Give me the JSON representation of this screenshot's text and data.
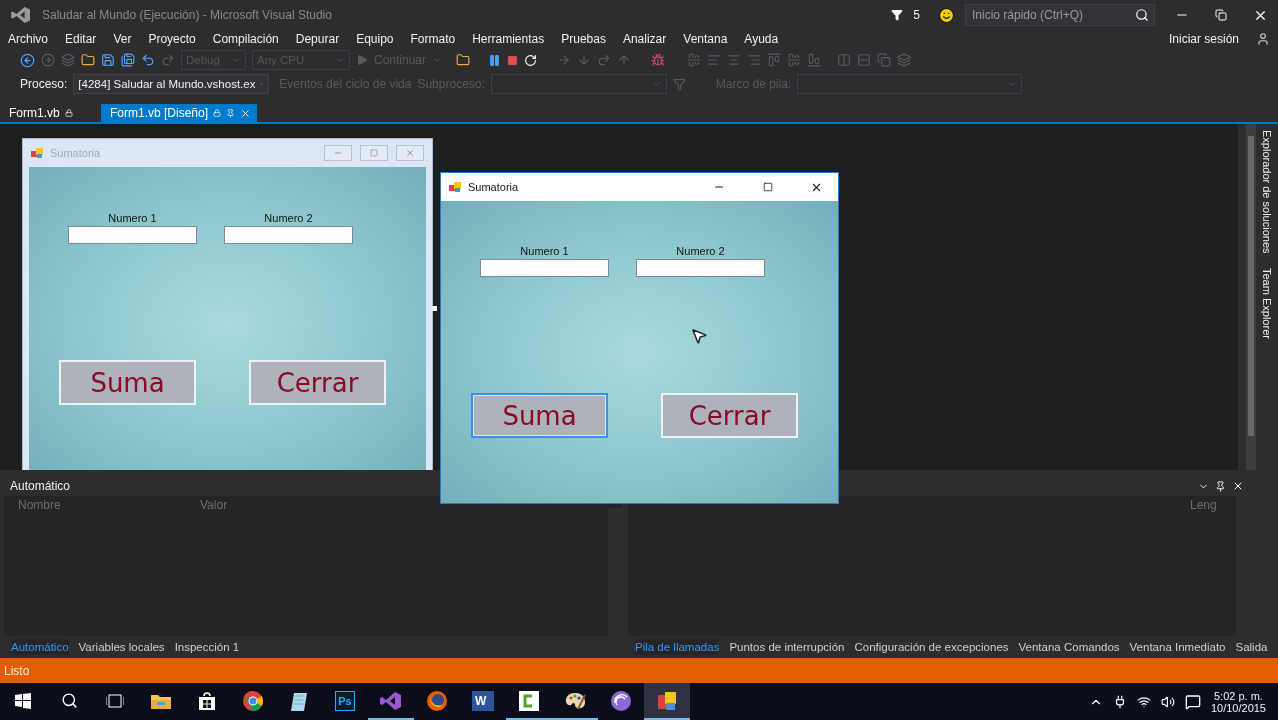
{
  "window": {
    "title": "Saludar al Mundo (Ejecución) - Microsoft Visual Studio"
  },
  "title_bar": {
    "notifications": "5",
    "quick_launch": {
      "placeholder": "Inicio rápido (Ctrl+Q)"
    }
  },
  "menu": [
    "Archivo",
    "Editar",
    "Ver",
    "Proyecto",
    "Compilación",
    "Depurar",
    "Equipo",
    "Formato",
    "Herramientas",
    "Pruebas",
    "Analizar",
    "Ventana",
    "Ayuda"
  ],
  "sign_in": "Iniciar sesión",
  "toolbar": {
    "configuration": "Debug",
    "platform": "Any CPU",
    "continue": "Continuar"
  },
  "debug_location": {
    "process_label": "Proceso:",
    "process": "[4284] Saludar al Mundo.vshost.ex",
    "lifecycle": "Eventos del ciclo de vida",
    "thread_label": "Subproceso:",
    "frame_label": "Marco de pila:"
  },
  "doc_tabs": [
    {
      "label": "Form1.vb",
      "selected": false
    },
    {
      "label": "Form1.vb [Diseño]",
      "selected": true
    }
  ],
  "side_tabs": [
    "Explorador de soluciones",
    "Team Explorer"
  ],
  "designer_form": {
    "title": "Sumatoria",
    "fields": [
      {
        "label": "Numero 1"
      },
      {
        "label": "Numero 2"
      }
    ],
    "buttons": [
      {
        "label": "Suma",
        "focused": false
      },
      {
        "label": "Cerrar",
        "focused": false
      }
    ]
  },
  "running_form": {
    "title": "Sumatoria",
    "fields": [
      {
        "label": "Numero 1"
      },
      {
        "label": "Numero 2"
      }
    ],
    "buttons": [
      {
        "label": "Suma",
        "focused": true
      },
      {
        "label": "Cerrar",
        "focused": false
      }
    ]
  },
  "autos_panel": {
    "title": "Automático",
    "columns": [
      "Nombre",
      "Valor"
    ],
    "tabs": [
      {
        "label": "Automático",
        "selected": true
      },
      {
        "label": "Variables locales",
        "selected": false
      },
      {
        "label": "Inspección 1",
        "selected": false
      }
    ]
  },
  "call_stack_panel": {
    "columns": [
      "Leng"
    ],
    "tabs": [
      {
        "label": "Pila de llamadas",
        "selected": true
      },
      {
        "label": "Puntos de interrupción",
        "selected": false
      },
      {
        "label": "Configuración de excepciones",
        "selected": false
      },
      {
        "label": "Ventana Comandos",
        "selected": false
      },
      {
        "label": "Ventana Inmediato",
        "selected": false
      },
      {
        "label": "Salida",
        "selected": false
      }
    ]
  },
  "status_bar": "Listo",
  "taskbar": {
    "apps": [
      {
        "kind": "start",
        "running": false
      },
      {
        "kind": "search",
        "running": false
      },
      {
        "kind": "taskview",
        "running": false
      },
      {
        "kind": "folder",
        "running": false
      },
      {
        "kind": "store",
        "running": false
      },
      {
        "kind": "browser",
        "running": false
      },
      {
        "kind": "notepad",
        "running": false
      },
      {
        "kind": "ps",
        "label": "Ps",
        "running": false
      },
      {
        "kind": "vs",
        "running": true
      },
      {
        "kind": "firefox",
        "running": false
      },
      {
        "kind": "word",
        "label": "W",
        "running": false
      },
      {
        "kind": "camtasia",
        "running": true
      },
      {
        "kind": "paint",
        "running": true
      },
      {
        "kind": "disc",
        "running": false
      },
      {
        "kind": "formapp",
        "running": true,
        "selected": true
      }
    ],
    "time": "5:02 p. m.",
    "date": "10/10/2015"
  }
}
